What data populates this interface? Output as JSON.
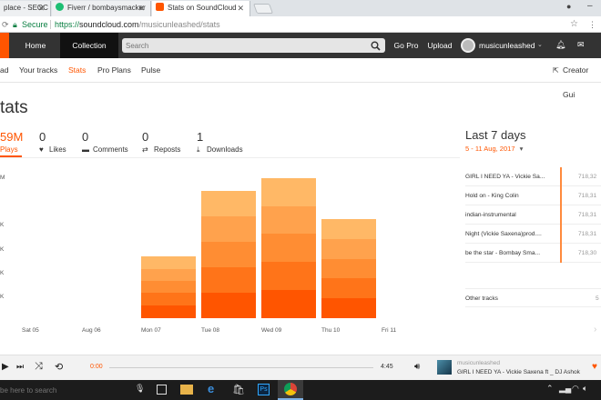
{
  "browser": {
    "tabs": [
      {
        "label": "place - SEOC",
        "active": false,
        "fav_color": "#e34a21"
      },
      {
        "label": "Fiverr / bombaysmacker",
        "active": false,
        "fav_color": "#1dbf73"
      },
      {
        "label": "Stats on SoundCloud",
        "active": true,
        "fav_color": "#f50"
      }
    ],
    "secure_label": "Secure",
    "url_prefix": "https://",
    "url_host": "soundcloud.com",
    "url_path": "/musicunleashed/stats"
  },
  "header": {
    "home_label": "Home",
    "collection_label": "Collection",
    "search_placeholder": "Search",
    "gopro_label": "Go Pro",
    "upload_label": "Upload",
    "username": "musicunleashed"
  },
  "subnav": {
    "items": [
      "ad",
      "Your tracks",
      "Stats",
      "Pro Plans",
      "Pulse"
    ],
    "creator_label": "Creator Gui"
  },
  "page": {
    "title": "tats",
    "range_title": "Last 7 days",
    "range_dates": "5 - 11 Aug, 2017"
  },
  "metrics": [
    {
      "value": "59M",
      "label": "Plays",
      "active": true
    },
    {
      "value": "0",
      "label": "Likes"
    },
    {
      "value": "0",
      "label": "Comments"
    },
    {
      "value": "0",
      "label": "Reposts"
    },
    {
      "value": "1",
      "label": "Downloads"
    }
  ],
  "chart_data": {
    "type": "bar",
    "categories": [
      "Sat 05",
      "Aug 06",
      "Mon 07",
      "Tue 08",
      "Wed 09",
      "Thu 10",
      "Fri 11"
    ],
    "y_ticks": [
      "M",
      "K",
      "K",
      "K",
      "K"
    ],
    "stacks": [
      [],
      [],
      [
        14,
        14,
        13,
        13,
        14
      ],
      [
        28,
        28,
        28,
        28,
        28
      ],
      [
        31,
        31,
        31,
        30,
        31
      ],
      [
        22,
        22,
        21,
        22,
        22
      ]
    ],
    "segment_colors": [
      "#ff5500",
      "#ff7419",
      "#ff8d33",
      "#ffa24d",
      "#ffb866"
    ]
  },
  "tracks": [
    {
      "name": "GIRL I NEED YA - Vickie Sa...",
      "plays": "718,32"
    },
    {
      "name": "Hold on - King Colin",
      "plays": "718,31"
    },
    {
      "name": "indian-instrumental",
      "plays": "718,31"
    },
    {
      "name": "Night (Vickie Saxena)prod....",
      "plays": "718,31"
    },
    {
      "name": "be the star - Bombay Sma...",
      "plays": "718,30"
    }
  ],
  "other_tracks": {
    "label": "Other tracks",
    "value": "5"
  },
  "player": {
    "time_current": "0:00",
    "time_total": "4:45",
    "artist": "musicunleashed",
    "title": "GIRL I NEED YA - Vickie Saxena ft _ DJ Ashok",
    "progress": 0
  },
  "taskbar": {
    "search_placeholder": "be here to search"
  }
}
